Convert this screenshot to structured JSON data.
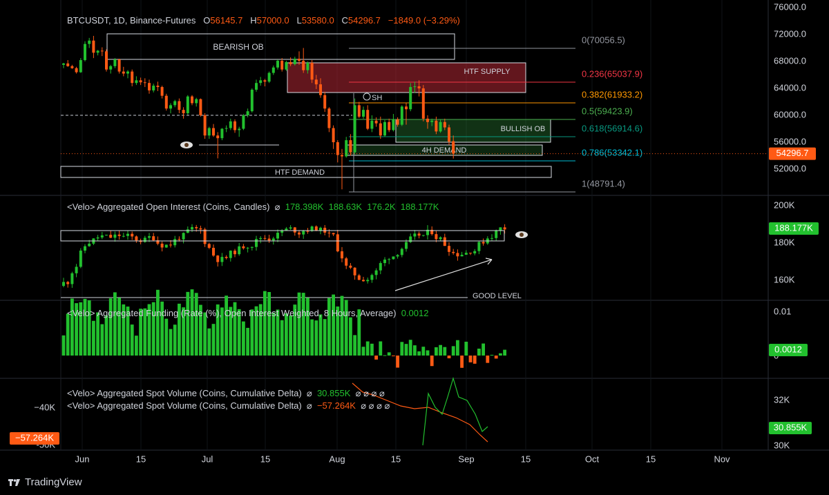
{
  "colors": {
    "up": "#22c02e",
    "down": "#ff5a14",
    "grid": "#1c1f26",
    "text": "#d1d4dc",
    "bg": "#000000"
  },
  "header": {
    "symbol": "BTCUSDT, 1D, Binance-Futures",
    "o_label": "O",
    "o": "56145.7",
    "h_label": "H",
    "h": "57000.0",
    "l_label": "L",
    "l": "53580.0",
    "c_label": "C",
    "c": "54296.7",
    "change": "−1849.0 (−3.29%)"
  },
  "oi_header": {
    "title": "<Velo> Aggregated Open Interest (Coins, Candles)",
    "sym": "⌀",
    "values": [
      "178.398K",
      "188.63K",
      "176.2K",
      "188.177K"
    ]
  },
  "funding_header": {
    "title": "<Velo> Aggregated Funding (Rate (%), Open Interest Weighted, 8 Hours, Average)",
    "value": "0.0012"
  },
  "spot_header_1": {
    "title": "<Velo> Aggregated Spot Volume (Coins, Cumulative Delta)",
    "sym": "⌀",
    "value": "30.855K",
    "tail": "⌀ ⌀ ⌀ ⌀"
  },
  "spot_header_2": {
    "title": "<Velo> Aggregated Spot Volume (Coins, Cumulative Delta)",
    "sym": "⌀",
    "value": "−57.264K",
    "tail": "⌀ ⌀ ⌀ ⌀"
  },
  "price_axis": [
    "76000.0",
    "72000.0",
    "68000.0",
    "64000.0",
    "60000.0",
    "56000.0",
    "52000.0"
  ],
  "price_tag": "54296.7",
  "oi_axis": [
    "200K",
    "180K",
    "160K"
  ],
  "oi_tag": "188.177K",
  "funding_axis": [
    "0.01",
    "0"
  ],
  "funding_tag": "0.0012",
  "spot_axis": [
    "32K",
    "30K"
  ],
  "spot_tag": "30.855K",
  "spot_left_axis": [
    "−40K",
    "-50K"
  ],
  "spot_left_tag": "−57.264K",
  "time_axis": [
    "Jun",
    "15",
    "Jul",
    "15",
    "Aug",
    "15",
    "Sep",
    "15",
    "Oct",
    "15",
    "Nov"
  ],
  "fib": [
    {
      "label": "0(70056.5)",
      "color": "#9598a1"
    },
    {
      "label": "0.236(65037.9)",
      "color": "#f23645"
    },
    {
      "label": "0.382(61933.2)",
      "color": "#ff9800"
    },
    {
      "label": "0.5(59423.9)",
      "color": "#4caf50"
    },
    {
      "label": "0.618(56914.6)",
      "color": "#089981"
    },
    {
      "label": "0.786(53342.1)",
      "color": "#00bcd4"
    },
    {
      "label": "1(48791.4)",
      "color": "#9598a1"
    }
  ],
  "zones": {
    "bearish_ob": "BEARISH OB",
    "htf_supply": "HTF SUPPLY",
    "bullish_ob": "BULLISH OB",
    "demand_4h": "4H DEMAND",
    "htf_demand": "HTF DEMAND",
    "sh": "SH",
    "good_level": "GOOD LEVEL"
  },
  "branding": "TradingView",
  "chart_data": {
    "type": "candlestick",
    "title": "BTCUSDT, 1D, Binance-Futures",
    "x_range": [
      "2024-06-01",
      "2024-09-06"
    ],
    "price_range": [
      48000,
      76000
    ],
    "candles": [
      [
        67500,
        67800,
        67000,
        67700
      ],
      [
        67700,
        68200,
        67200,
        67300
      ],
      [
        67300,
        67500,
        66900,
        67000
      ],
      [
        67000,
        67200,
        66200,
        66400
      ],
      [
        66400,
        68500,
        66300,
        68200
      ],
      [
        68200,
        71000,
        68000,
        70600
      ],
      [
        70600,
        71500,
        70000,
        71100
      ],
      [
        71100,
        71800,
        68500,
        69300
      ],
      [
        69300,
        69700,
        68900,
        69600
      ],
      [
        69600,
        70100,
        68800,
        69500
      ],
      [
        69500,
        69800,
        66500,
        66800
      ],
      [
        66800,
        67500,
        66200,
        67300
      ],
      [
        67300,
        68500,
        67000,
        68300
      ],
      [
        68300,
        68400,
        66200,
        66500
      ],
      [
        66500,
        67200,
        65800,
        66200
      ],
      [
        66200,
        66700,
        65500,
        66500
      ],
      [
        66500,
        66800,
        64300,
        64800
      ],
      [
        64800,
        65800,
        64500,
        65200
      ],
      [
        65200,
        65600,
        64500,
        64900
      ],
      [
        64900,
        65500,
        64200,
        64800
      ],
      [
        64800,
        65300,
        63200,
        63700
      ],
      [
        63700,
        64700,
        63400,
        64400
      ],
      [
        64400,
        65000,
        63600,
        64200
      ],
      [
        64200,
        64400,
        62500,
        62900
      ],
      [
        62900,
        63200,
        60700,
        61000
      ],
      [
        61000,
        61800,
        60300,
        61500
      ],
      [
        61500,
        62300,
        61200,
        62100
      ],
      [
        62100,
        62500,
        60300,
        60800
      ],
      [
        60800,
        61200,
        59500,
        60300
      ],
      [
        60300,
        63000,
        60100,
        62800
      ],
      [
        62800,
        63000,
        61500,
        61800
      ],
      [
        61800,
        62600,
        61300,
        62400
      ],
      [
        62400,
        62500,
        59800,
        60000
      ],
      [
        60000,
        60300,
        56500,
        57000
      ],
      [
        57000,
        58300,
        56500,
        58100
      ],
      [
        58100,
        58700,
        56800,
        57000
      ],
      [
        57000,
        57500,
        53600,
        56600
      ],
      [
        56600,
        58100,
        56300,
        58000
      ],
      [
        58000,
        58500,
        57500,
        58100
      ],
      [
        58100,
        59500,
        57800,
        59100
      ],
      [
        59100,
        59400,
        57400,
        57800
      ],
      [
        57800,
        58300,
        56800,
        58000
      ],
      [
        58000,
        60200,
        57800,
        60000
      ],
      [
        60000,
        61000,
        59700,
        60600
      ],
      [
        60600,
        64000,
        60400,
        63800
      ],
      [
        63800,
        65300,
        63500,
        64800
      ],
      [
        64800,
        65700,
        64400,
        65200
      ],
      [
        65200,
        65400,
        64300,
        65000
      ],
      [
        65000,
        66500,
        64800,
        66300
      ],
      [
        66300,
        67400,
        66000,
        67100
      ],
      [
        67100,
        68300,
        66800,
        68100
      ],
      [
        68100,
        68500,
        66500,
        66800
      ],
      [
        66800,
        68100,
        66600,
        67900
      ],
      [
        67900,
        68600,
        67300,
        67600
      ],
      [
        67600,
        68700,
        67400,
        68400
      ],
      [
        68400,
        69500,
        67500,
        68100
      ],
      [
        68100,
        70000,
        66300,
        66700
      ],
      [
        66700,
        68000,
        66200,
        67800
      ],
      [
        67800,
        68200,
        64800,
        65300
      ],
      [
        65300,
        66000,
        63900,
        64600
      ],
      [
        64600,
        65500,
        62600,
        63000
      ],
      [
        63000,
        63500,
        60500,
        61000
      ],
      [
        61000,
        61200,
        57500,
        58100
      ],
      [
        58100,
        58500,
        55000,
        56000
      ],
      [
        56000,
        56300,
        53000,
        54100
      ],
      [
        54100,
        55000,
        49000,
        53900
      ],
      [
        53900,
        56800,
        53700,
        56300
      ],
      [
        56300,
        57200,
        54000,
        54500
      ],
      [
        54500,
        62500,
        54200,
        61500
      ],
      [
        61500,
        62000,
        59600,
        59800
      ],
      [
        59800,
        61300,
        59500,
        60800
      ],
      [
        60800,
        61500,
        57800,
        58000
      ],
      [
        58000,
        60000,
        57500,
        59200
      ],
      [
        59200,
        59700,
        58300,
        58800
      ],
      [
        58800,
        59800,
        56500,
        57000
      ],
      [
        57000,
        59300,
        56800,
        59000
      ],
      [
        59000,
        59500,
        57500,
        57800
      ],
      [
        57800,
        60200,
        57600,
        59400
      ],
      [
        59400,
        59700,
        58300,
        58600
      ],
      [
        58600,
        61500,
        58400,
        61300
      ],
      [
        61300,
        61800,
        58600,
        60900
      ],
      [
        60900,
        64800,
        60600,
        64200
      ],
      [
        64200,
        65000,
        63300,
        64300
      ],
      [
        64300,
        65200,
        62800,
        64000
      ],
      [
        64000,
        64500,
        59100,
        59500
      ],
      [
        59500,
        60000,
        58000,
        59000
      ],
      [
        59000,
        59500,
        58400,
        59200
      ],
      [
        59200,
        59800,
        57200,
        57600
      ],
      [
        57600,
        59400,
        57400,
        59000
      ],
      [
        59000,
        59500,
        57800,
        58200
      ],
      [
        58200,
        58600,
        55600,
        56100
      ],
      [
        56145.7,
        57000,
        53580,
        54296.7
      ]
    ],
    "open_interest": {
      "unit": "K",
      "range": [
        150,
        210
      ],
      "latest": 188.177
    },
    "funding_rate": {
      "unit": "%",
      "latest": 0.0012
    },
    "spot_cvd": {
      "series": [
        {
          "value": 30.855
        },
        {
          "value": -57.264
        }
      ]
    }
  }
}
